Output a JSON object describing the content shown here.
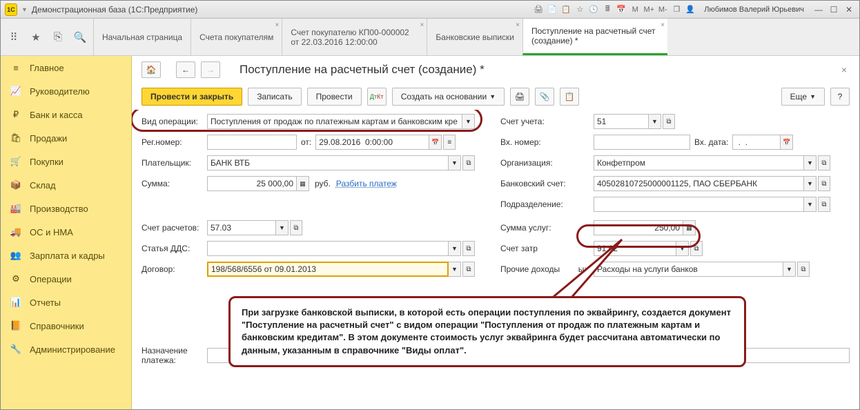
{
  "titlebar": {
    "app_title": "Демонстрационная база  (1С:Предприятие)",
    "user": "Любимов Валерий Юрьевич",
    "m_labels": [
      "M",
      "M+",
      "M-"
    ]
  },
  "tabs": [
    {
      "label": "Начальная страница",
      "closable": false
    },
    {
      "label": "Счета покупателям",
      "closable": true
    },
    {
      "label": "Счет покупателю КП00-000002 от 22.03.2016 12:00:00",
      "closable": true
    },
    {
      "label": "Банковские выписки",
      "closable": true
    },
    {
      "label": "Поступление на расчетный счет (создание) *",
      "closable": true,
      "active": true
    }
  ],
  "sidebar": [
    {
      "icon": "≡",
      "label": "Главное"
    },
    {
      "icon": "📈",
      "label": "Руководителю"
    },
    {
      "icon": "₽",
      "label": "Банк и касса"
    },
    {
      "icon": "🛍",
      "label": "Продажи"
    },
    {
      "icon": "🛒",
      "label": "Покупки"
    },
    {
      "icon": "📦",
      "label": "Склад"
    },
    {
      "icon": "🏭",
      "label": "Производство"
    },
    {
      "icon": "🚚",
      "label": "ОС и НМА"
    },
    {
      "icon": "👥",
      "label": "Зарплата и кадры"
    },
    {
      "icon": "⚙",
      "label": "Операции"
    },
    {
      "icon": "📊",
      "label": "Отчеты"
    },
    {
      "icon": "📙",
      "label": "Справочники"
    },
    {
      "icon": "🔧",
      "label": "Администрирование"
    }
  ],
  "page": {
    "title": "Поступление на расчетный счет (создание) *"
  },
  "toolbar": {
    "post_close": "Провести и закрыть",
    "save": "Записать",
    "post": "Провести",
    "create_based": "Создать на основании",
    "more": "Еще",
    "help": "?"
  },
  "form": {
    "op_type_label": "Вид операции:",
    "op_type_value": "Поступления от продаж по платежным картам и банковским кре",
    "account_label": "Счет учета:",
    "account_value": "51",
    "reg_label": "Рег.номер:",
    "reg_value": "",
    "from_label": "от:",
    "date_value": "29.08.2016  0:00:00",
    "in_number_label": "Вх. номер:",
    "in_number_value": "",
    "in_date_label": "Вх. дата:",
    "in_date_value": " .  .    ",
    "payer_label": "Плательщик:",
    "payer_value": "БАНК ВТБ",
    "org_label": "Организация:",
    "org_value": "Конфетпром",
    "sum_label": "Сумма:",
    "sum_value": "25 000,00",
    "currency": "руб.",
    "split_link": "Разбить платеж",
    "bank_acc_label": "Банковский счет:",
    "bank_acc_value": "40502810725000001125, ПАО СБЕРБАНК",
    "dept_label": "Подразделение:",
    "dept_value": "",
    "calc_acc_label": "Счет расчетов:",
    "calc_acc_value": "57.03",
    "service_sum_label": "Сумма услуг:",
    "service_sum_value": "250,00",
    "dds_label": "Статья ДДС:",
    "dds_value": "",
    "cost_acc_label": "Счет затр",
    "cost_acc_value": "91.02",
    "contract_label": "Договор:",
    "contract_value": "198/568/6556 от 09.01.2013",
    "other_income_label": "Прочие доходы",
    "other_income_suffix": "ы:",
    "other_income_value": "Расходы на услуги банков",
    "purpose_label": "Назначение платежа:",
    "purpose_value": ""
  },
  "callout": {
    "text": "При загрузке банковской выписки, в которой есть операции поступления по эквайрингу, создается документ \"Поступление на расчетный счет\" с видом операции \"Поступления от продаж по платежным картам и банковским кредитам\". В этом документе стоимость услуг эквайринга будет рассчитана автоматически по данным, указанным в справочнике \"Виды оплат\"."
  }
}
